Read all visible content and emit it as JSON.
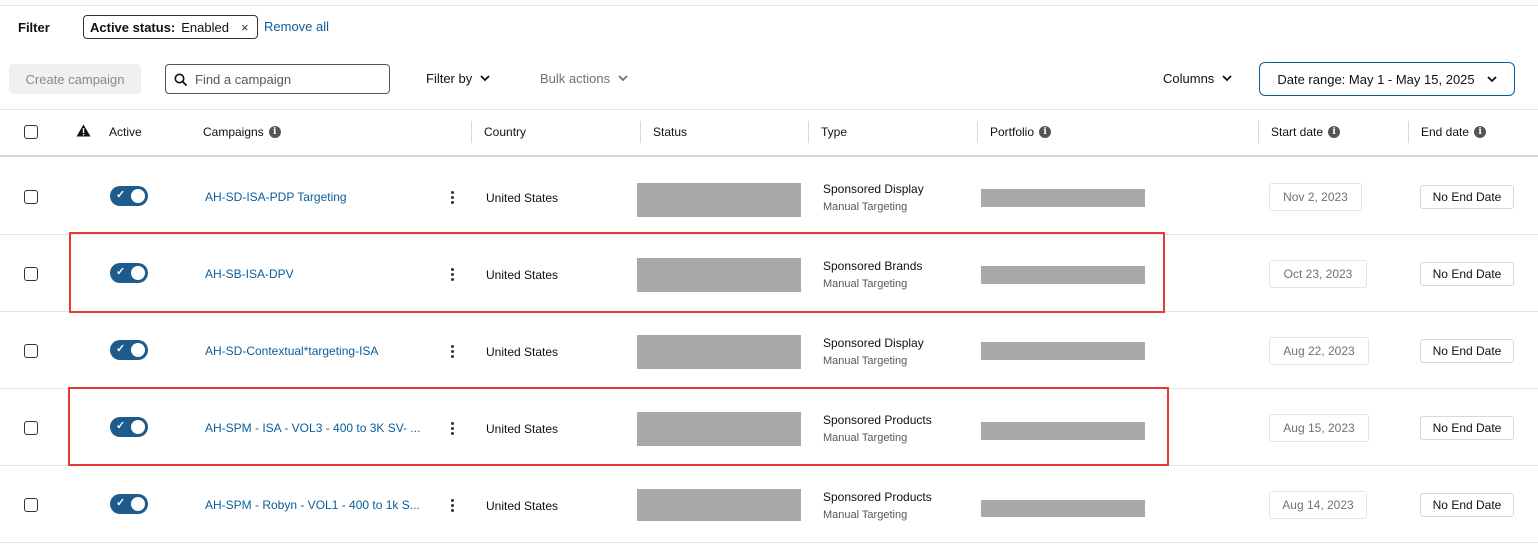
{
  "filter": {
    "label": "Filter",
    "chip_key": "Active status:",
    "chip_value": "Enabled",
    "chip_close": "×",
    "remove_all": "Remove all"
  },
  "toolbar": {
    "create_campaign": "Create campaign",
    "search_placeholder": "Find a campaign",
    "filter_by": "Filter by",
    "bulk_actions": "Bulk actions",
    "columns": "Columns",
    "date_range": "Date range: May 1 - May 15, 2025"
  },
  "table": {
    "headers": {
      "warning_icon": "warning-icon",
      "active": "Active",
      "campaigns": "Campaigns",
      "country": "Country",
      "status": "Status",
      "type": "Type",
      "portfolio": "Portfolio",
      "start_date": "Start date",
      "end_date": "End date"
    },
    "rows": [
      {
        "campaign": "AH-SD-ISA-PDP Targeting",
        "country": "United States",
        "type": "Sponsored Display",
        "targeting": "Manual Targeting",
        "start_date": "Nov 2, 2023",
        "end_date": "No End Date",
        "active": true
      },
      {
        "campaign": "AH-SB-ISA-DPV",
        "country": "United States",
        "type": "Sponsored Brands",
        "targeting": "Manual Targeting",
        "start_date": "Oct 23, 2023",
        "end_date": "No End Date",
        "active": true
      },
      {
        "campaign": "AH-SD-Contextual*targeting-ISA",
        "country": "United States",
        "type": "Sponsored Display",
        "targeting": "Manual Targeting",
        "start_date": "Aug 22, 2023",
        "end_date": "No End Date",
        "active": true
      },
      {
        "campaign": "AH-SPM - ISA - VOL3 - 400 to 3K SV- ...",
        "country": "United States",
        "type": "Sponsored Products",
        "targeting": "Manual Targeting",
        "start_date": "Aug 15, 2023",
        "end_date": "No End Date",
        "active": true
      },
      {
        "campaign": "AH-SPM - Robyn - VOL1 - 400 to 1k S...",
        "country": "United States",
        "type": "Sponsored Products",
        "targeting": "Manual Targeting",
        "start_date": "Aug 14, 2023",
        "end_date": "No End Date",
        "active": true
      }
    ]
  },
  "colors": {
    "link": "#0a5d9b",
    "toggle_on": "#1e5b8a",
    "highlight": "#e53935",
    "redaction": "#a9a9ab"
  }
}
